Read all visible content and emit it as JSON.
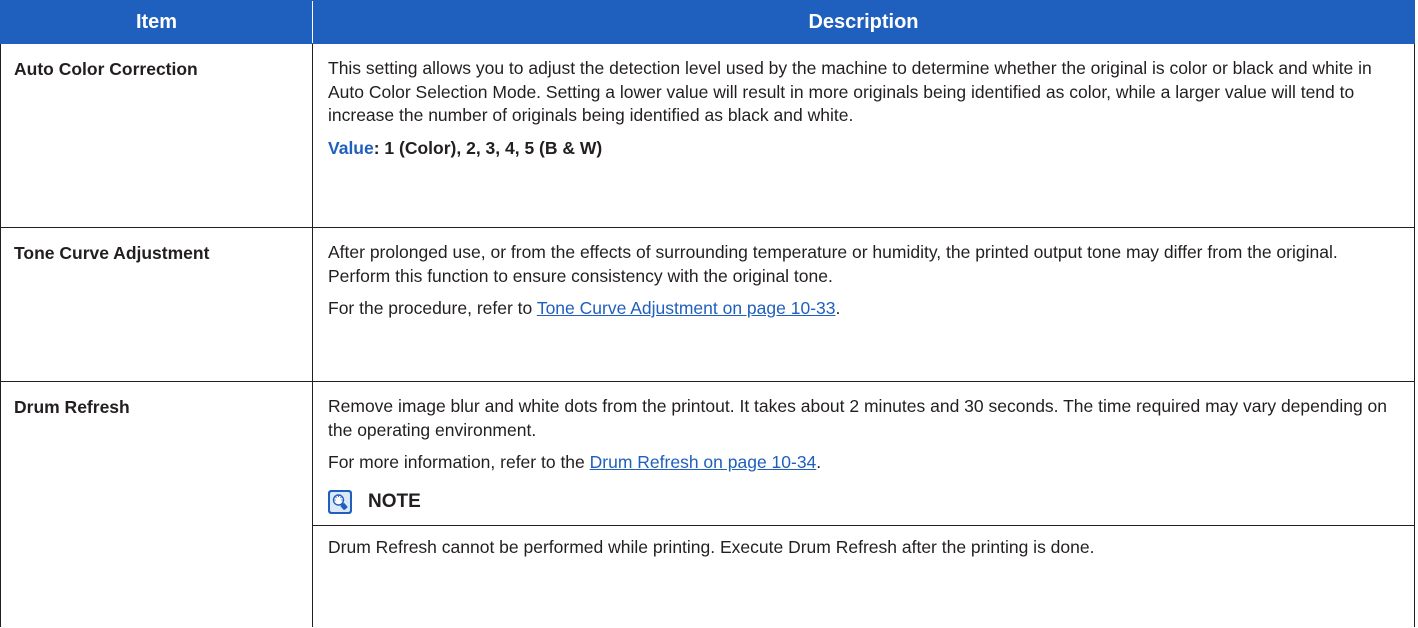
{
  "header": {
    "col_item": "Item",
    "col_description": "Description"
  },
  "rows": [
    {
      "item": "Auto Color Correction",
      "desc": "This setting allows you to adjust the detection level used by the machine to determine whether the original is color or black and white in Auto Color Selection Mode. Setting a lower value will result in more originals being identified as color, while a larger value will tend to increase the number of originals being identified as black and white.",
      "value_label": "Value",
      "value_text": ": 1 (Color), 2, 3, 4, 5 (B & W)"
    },
    {
      "item": "Tone Curve Adjustment",
      "desc": "After prolonged use, or from the effects of surrounding temperature or humidity, the printed output tone may differ from the original. Perform this function to ensure consistency with the original tone.",
      "ref_prefix": "For the procedure, refer to ",
      "ref_link": "Tone Curve Adjustment on page 10-33",
      "ref_suffix": "."
    },
    {
      "item": "Drum Refresh",
      "desc": "Remove image blur and white dots from the printout. It takes about 2 minutes and 30 seconds. The time required may vary depending on the operating environment.",
      "ref_prefix": "For more information, refer to the ",
      "ref_link": "Drum Refresh on page 10-34",
      "ref_suffix": ".",
      "note_title": "NOTE",
      "note_text": "Drum Refresh cannot be performed while printing. Execute Drum Refresh after the printing is done."
    }
  ],
  "colors": {
    "header_bg": "#1f5fbd",
    "link": "#1f5fbd",
    "text": "#231f20"
  },
  "icons": {
    "note": "note-lightbulb-icon"
  }
}
